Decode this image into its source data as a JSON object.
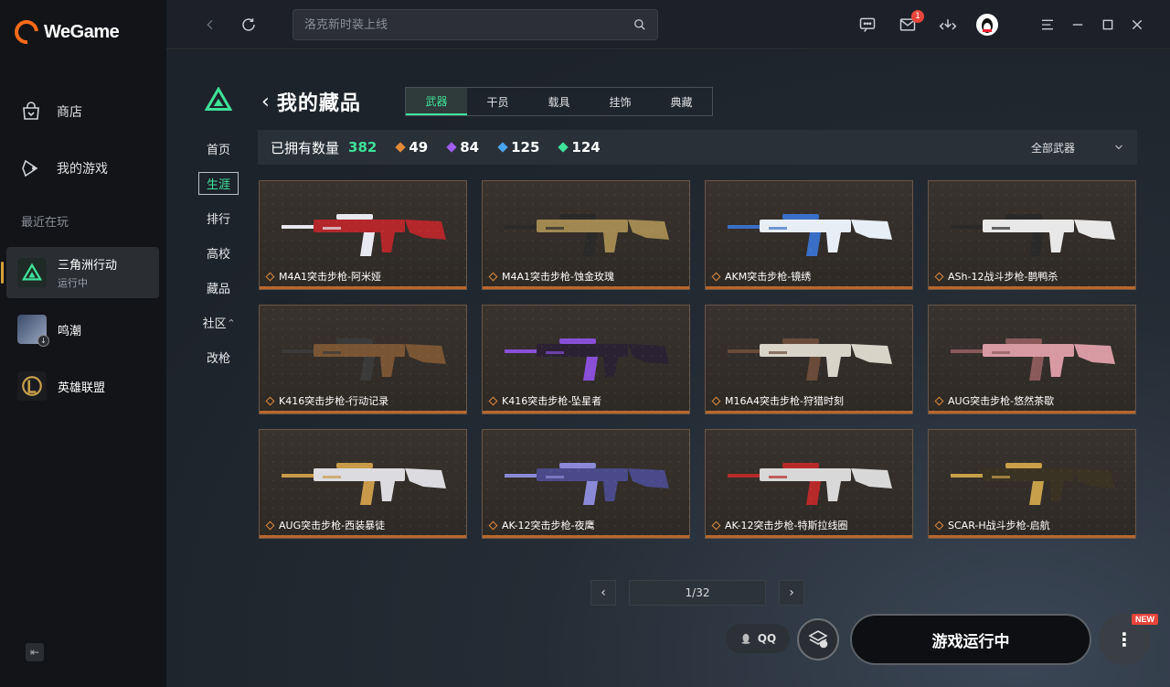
{
  "app": {
    "name": "WeGame"
  },
  "sidebar": {
    "nav": [
      {
        "label": "商店",
        "icon": "shop-bag-icon"
      },
      {
        "label": "我的游戏",
        "icon": "gamepad-icon"
      }
    ],
    "recent_label": "最近在玩",
    "games": [
      {
        "name": "三角洲行动",
        "status": "运行中",
        "icon": "delta-force-icon"
      },
      {
        "name": "鸣潮",
        "status": "",
        "icon": "wuthering-waves-icon"
      },
      {
        "name": "英雄联盟",
        "status": "",
        "icon": "league-icon"
      }
    ]
  },
  "topbar": {
    "search_placeholder": "洛克新时装上线",
    "mail_badge": "1"
  },
  "subnav": {
    "items": [
      "首页",
      "生涯",
      "排行",
      "高校",
      "藏品",
      "社区",
      "改枪"
    ],
    "active": "生涯"
  },
  "page": {
    "title": "我的藏品",
    "tabs": [
      "武器",
      "干员",
      "载具",
      "挂饰",
      "典藏"
    ],
    "active_tab": "武器"
  },
  "stats": {
    "label": "已拥有数量",
    "total": "382",
    "counts": [
      {
        "value": "49",
        "color": "#e08a3a"
      },
      {
        "value": "84",
        "color": "#a15cf0"
      },
      {
        "value": "125",
        "color": "#4aa3f0"
      },
      {
        "value": "124",
        "color": "#3ee29a"
      }
    ],
    "filter_label": "全部武器"
  },
  "items": [
    {
      "name": "M4A1突击步枪-阿米娅",
      "main": "#b3262a",
      "accent": "#e8e8f0"
    },
    {
      "name": "M4A1突击步枪-蚀金玫瑰",
      "main": "#a08850",
      "accent": "#2a2a2a"
    },
    {
      "name": "AKM突击步枪-镜绣",
      "main": "#e8eef5",
      "accent": "#3a6fc8"
    },
    {
      "name": "ASh-12战斗步枪-鹊鸭杀",
      "main": "#e8e8e8",
      "accent": "#2a2a2a"
    },
    {
      "name": "K416突击步枪-行动记录",
      "main": "#7a5534",
      "accent": "#3a3a3a"
    },
    {
      "name": "K416突击步枪-坠星者",
      "main": "#2a2233",
      "accent": "#8a4fd8"
    },
    {
      "name": "M16A4突击步枪-狩猎时刻",
      "main": "#d8d4c8",
      "accent": "#6a4a38"
    },
    {
      "name": "AUG突击步枪-悠然茶歇",
      "main": "#d89aa2",
      "accent": "#8a5a5a"
    },
    {
      "name": "AUG突击步枪-西装暴徒",
      "main": "#dcdce0",
      "accent": "#c89a4a"
    },
    {
      "name": "AK-12突击步枪-夜鹰",
      "main": "#4a4a8a",
      "accent": "#8a8ad8"
    },
    {
      "name": "AK-12突击步枪-特斯拉线圈",
      "main": "#d8d8d8",
      "accent": "#b82a2a"
    },
    {
      "name": "SCAR-H战斗步枪-启航",
      "main": "#3a3222",
      "accent": "#c8a04a"
    }
  ],
  "pagination": {
    "current": "1/32"
  },
  "bottom": {
    "qq_label": "QQ",
    "launch_label": "游戏运行中",
    "new_tag": "NEW"
  }
}
